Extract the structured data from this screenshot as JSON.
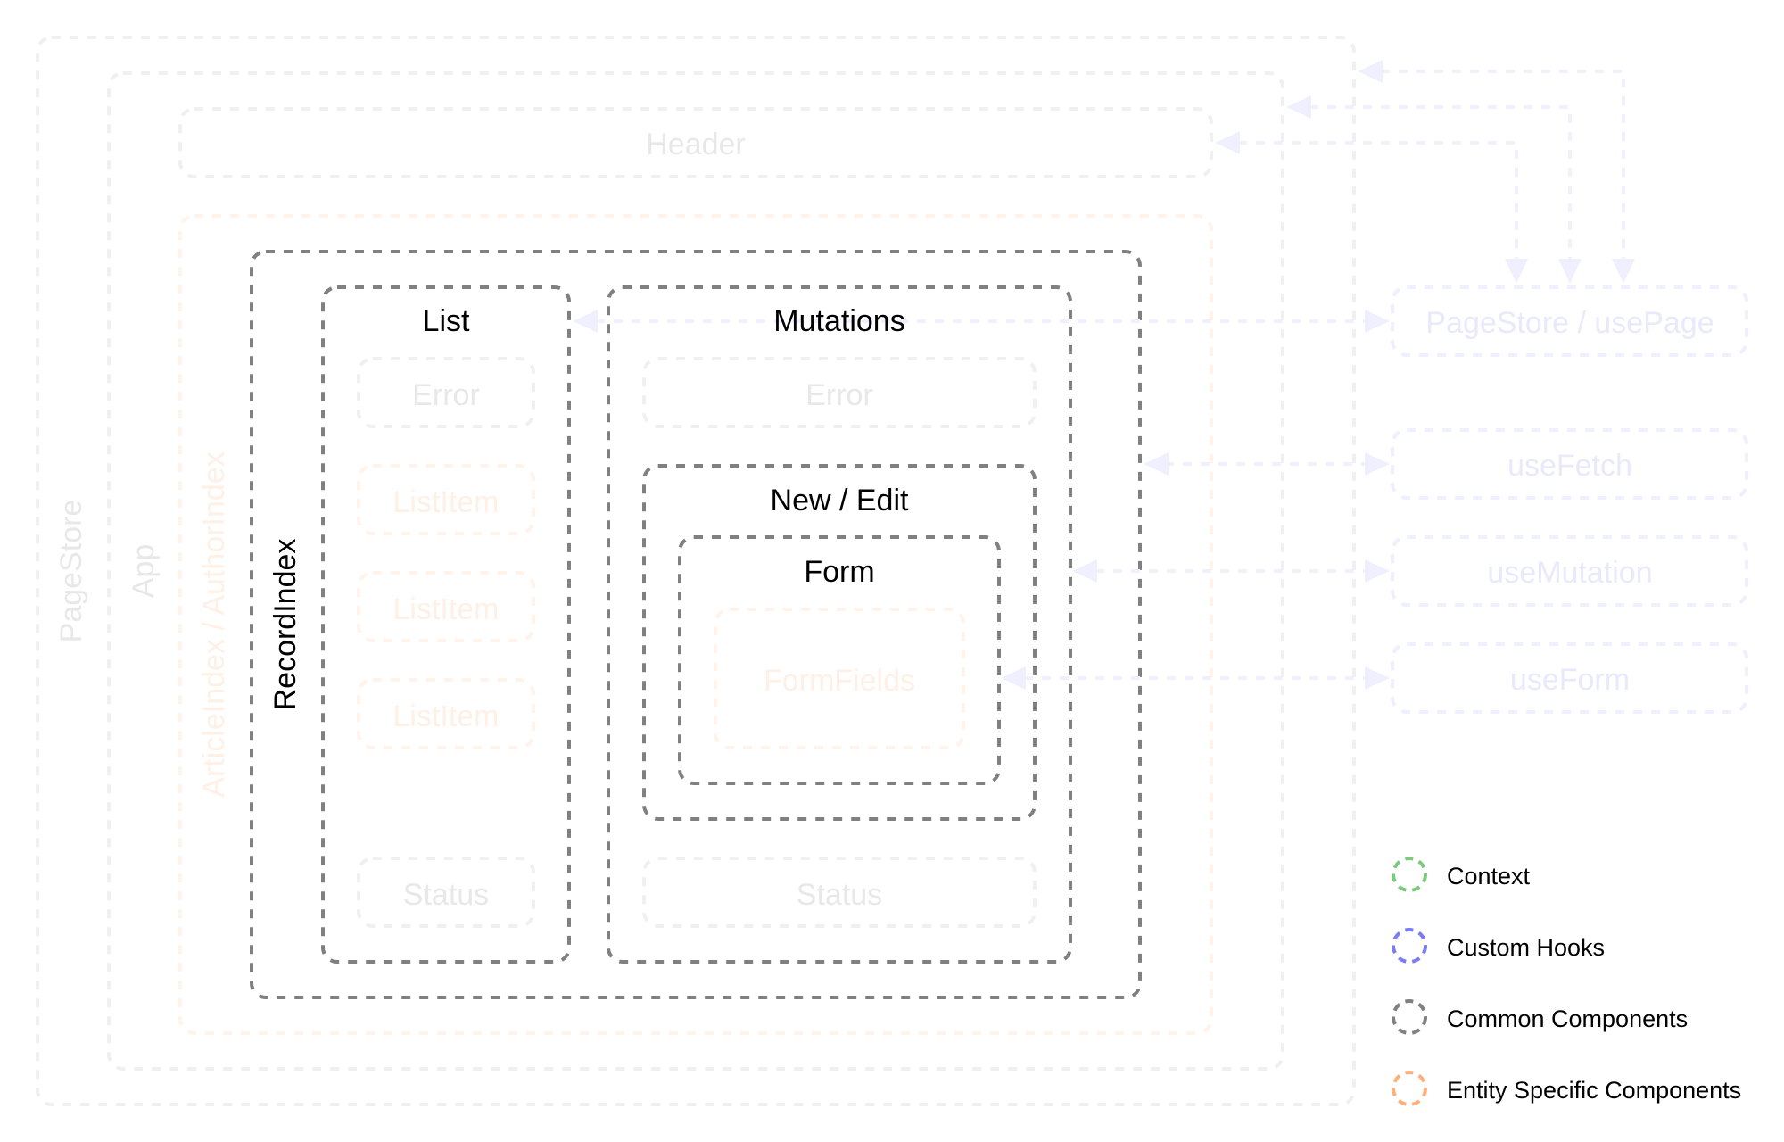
{
  "diagram": {
    "containers": {
      "pagestore": "PageStore",
      "app": "App",
      "header": "Header",
      "entity_index": "ArticleIndex / AuthorIndex",
      "record_index": "RecordIndex",
      "list": "List",
      "mutations": "Mutations",
      "new_edit": "New / Edit",
      "form": "Form",
      "form_fields": "FormFields"
    },
    "list_children": {
      "error": "Error",
      "items": [
        "ListItem",
        "ListItem",
        "ListItem"
      ],
      "status": "Status"
    },
    "mutation_children": {
      "error": "Error",
      "status": "Status"
    },
    "hooks": {
      "page_store": "PageStore / usePage",
      "use_fetch": "useFetch",
      "use_mutation": "useMutation",
      "use_form": "useForm"
    }
  },
  "legend": [
    {
      "label": "Context",
      "color": "#7dc97d"
    },
    {
      "label": "Custom Hooks",
      "color": "#7b7bf5"
    },
    {
      "label": "Common Components",
      "color": "#808080"
    },
    {
      "label": "Entity Specific Components",
      "color": "#ffb07a"
    }
  ],
  "colors": {
    "common": "#808080",
    "context_faded": "#f0f0f0",
    "entity_faded": "#fff3ea",
    "hook_faded": "#efeffd"
  }
}
